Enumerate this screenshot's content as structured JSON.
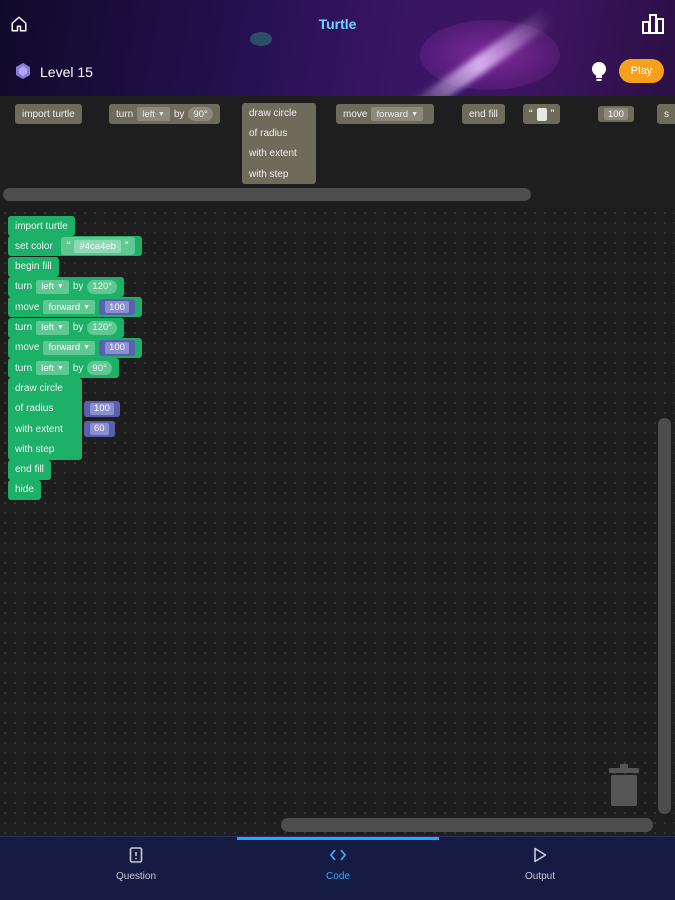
{
  "header": {
    "title": "Turtle",
    "level_label": "Level 15",
    "play_label": "Play"
  },
  "toolbox": {
    "import_turtle": "import turtle",
    "turn": {
      "prefix": "turn",
      "dir": "left",
      "by": "by",
      "deg": "90°"
    },
    "draw_circle": [
      "draw circle",
      "of radius",
      "with extent",
      "with step"
    ],
    "move": {
      "prefix": "move",
      "dir": "forward"
    },
    "end_fill": "end fill",
    "string_open": "“",
    "string_close": "”",
    "number": "100",
    "partial": "s"
  },
  "workspace": {
    "blocks": [
      {
        "type": "text",
        "label": "import turtle"
      },
      {
        "type": "set_color",
        "label": "set color",
        "open": "“",
        "value": "#4ca4eb",
        "close": "”"
      },
      {
        "type": "text",
        "label": "begin fill"
      },
      {
        "type": "turn",
        "label": "turn",
        "dir": "left",
        "by": "by",
        "deg": "120°"
      },
      {
        "type": "move",
        "label": "move",
        "dir": "forward",
        "value": "100"
      },
      {
        "type": "turn",
        "label": "turn",
        "dir": "left",
        "by": "by",
        "deg": "120°"
      },
      {
        "type": "move",
        "label": "move",
        "dir": "forward",
        "value": "100"
      },
      {
        "type": "turn",
        "label": "turn",
        "dir": "left",
        "by": "by",
        "deg": "90°"
      }
    ],
    "circle": {
      "rows": [
        "draw circle",
        "of radius",
        "with extent",
        "with step"
      ],
      "radius": "100",
      "extent": "60"
    },
    "tail": [
      "end fill",
      "hide"
    ]
  },
  "nav": {
    "question": "Question",
    "code": "Code",
    "output": "Output"
  },
  "colors": {
    "accent_title": "#6fd4ff",
    "play_button": "#f6a11b",
    "block_green": "#1db069",
    "block_grey": "#6e6b5b",
    "number_purple": "#5b5fb0",
    "nav_active": "#2fa5ff"
  }
}
